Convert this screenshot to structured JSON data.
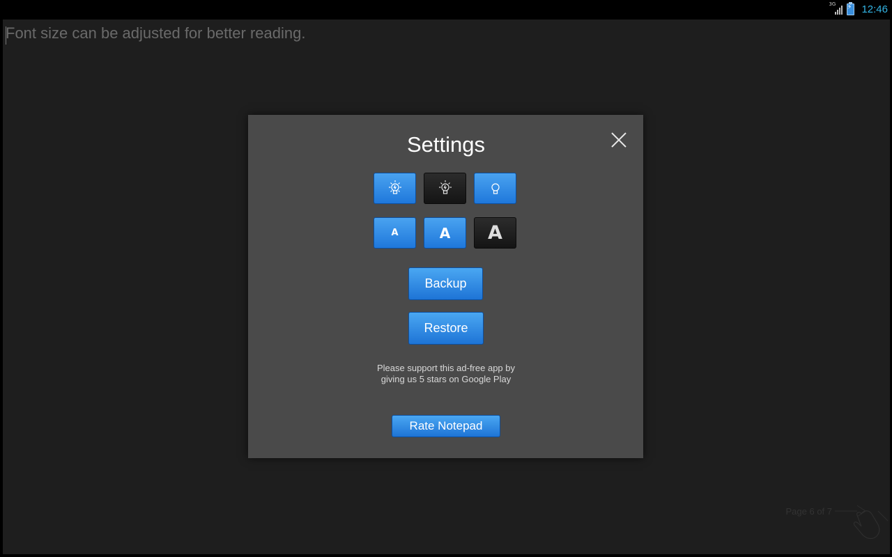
{
  "status_bar": {
    "network_type": "3G",
    "time": "12:46",
    "icons": [
      "signal-icon",
      "battery-charging-icon"
    ]
  },
  "note": {
    "text": "Font size can be adjusted for better reading.",
    "page_indicator": "Page 6 of 7"
  },
  "settings_dialog": {
    "title": "Settings",
    "theme_options": [
      {
        "icon": "bulb-bright-icon",
        "selected": false
      },
      {
        "icon": "bulb-dark-icon",
        "selected": true
      },
      {
        "icon": "bulb-off-icon",
        "selected": false
      }
    ],
    "font_sizes": [
      {
        "label": "A",
        "size": "small",
        "selected": false
      },
      {
        "label": "A",
        "size": "medium",
        "selected": false
      },
      {
        "label": "A",
        "size": "large",
        "selected": true
      }
    ],
    "backup_label": "Backup",
    "restore_label": "Restore",
    "support_message": "Please support this ad-free app by giving us 5 stars on Google Play",
    "rate_label": "Rate Notepad"
  },
  "colors": {
    "accent_blue": "#2a86e6",
    "dialog_bg": "#4a4a4a",
    "clock": "#33b5e5"
  }
}
